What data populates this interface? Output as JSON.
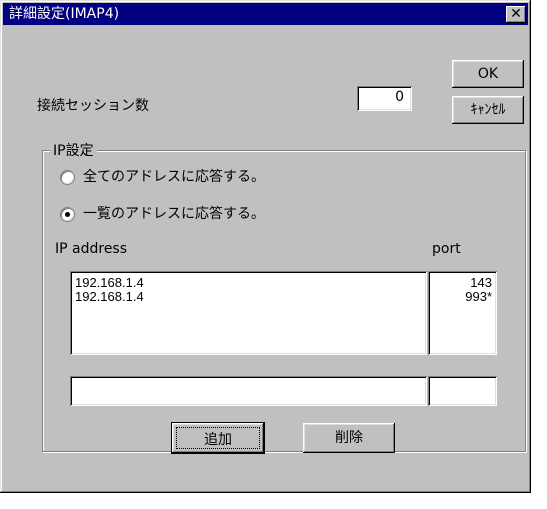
{
  "window": {
    "title": "詳細設定(IMAP4)",
    "close_glyph": "✕"
  },
  "session": {
    "label": "接続セッション数",
    "value": "0"
  },
  "buttons": {
    "ok": "OK",
    "cancel": "ｷｬﾝｾﾙ",
    "add": "追加",
    "delete": "削除"
  },
  "ip_group": {
    "legend": "IP設定",
    "radio_all": "全てのアドレスに応答する。",
    "radio_list": "一覧のアドレスに応答する。",
    "selected": "list"
  },
  "table": {
    "col_ip": "IP address",
    "col_port": "port",
    "rows": [
      {
        "ip": "192.168.1.4",
        "port": "143"
      },
      {
        "ip": "192.168.1.4",
        "port": "993*"
      }
    ]
  },
  "entry": {
    "ip": "",
    "port": ""
  }
}
